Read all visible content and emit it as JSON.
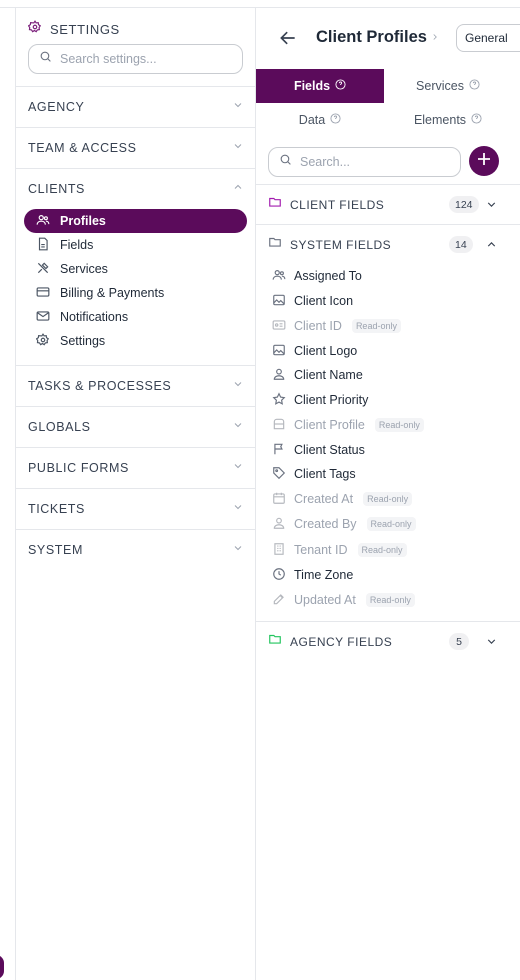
{
  "sidebar": {
    "header": "SETTINGS",
    "search_placeholder": "Search settings...",
    "sections": [
      {
        "label": "AGENCY",
        "expanded": false
      },
      {
        "label": "TEAM & ACCESS",
        "expanded": false
      },
      {
        "label": "CLIENTS",
        "expanded": true
      },
      {
        "label": "TASKS & PROCESSES",
        "expanded": false
      },
      {
        "label": "GLOBALS",
        "expanded": false
      },
      {
        "label": "PUBLIC FORMS",
        "expanded": false
      },
      {
        "label": "TICKETS",
        "expanded": false
      },
      {
        "label": "SYSTEM",
        "expanded": false
      }
    ],
    "clients_items": [
      {
        "label": "Profiles",
        "icon": "users-icon",
        "active": true
      },
      {
        "label": "Fields",
        "icon": "document-icon",
        "active": false
      },
      {
        "label": "Services",
        "icon": "tools-icon",
        "active": false
      },
      {
        "label": "Billing & Payments",
        "icon": "credit-card-icon",
        "active": false
      },
      {
        "label": "Notifications",
        "icon": "mail-icon",
        "active": false
      },
      {
        "label": "Settings",
        "icon": "gear-icon",
        "active": false
      }
    ]
  },
  "header": {
    "title": "Client Profiles",
    "select_value": "General"
  },
  "tabs": [
    {
      "label": "Fields",
      "active": true
    },
    {
      "label": "Services",
      "active": false
    },
    {
      "label": "Data",
      "active": false
    },
    {
      "label": "Elements",
      "active": false
    }
  ],
  "search_placeholder": "Search...",
  "groups": {
    "client": {
      "label": "CLIENT FIELDS",
      "count": "124",
      "expanded": false
    },
    "system": {
      "label": "SYSTEM FIELDS",
      "count": "14",
      "expanded": true
    },
    "agency": {
      "label": "AGENCY FIELDS",
      "count": "5",
      "expanded": false
    }
  },
  "readonly_label": "Read-only",
  "system_fields": [
    {
      "label": "Assigned To",
      "icon": "users-icon",
      "readonly": false
    },
    {
      "label": "Client Icon",
      "icon": "image-icon",
      "readonly": false
    },
    {
      "label": "Client ID",
      "icon": "id-card-icon",
      "readonly": true
    },
    {
      "label": "Client Logo",
      "icon": "image-icon",
      "readonly": false
    },
    {
      "label": "Client Name",
      "icon": "person-icon",
      "readonly": false
    },
    {
      "label": "Client Priority",
      "icon": "star-icon",
      "readonly": false
    },
    {
      "label": "Client Profile",
      "icon": "folder-card-icon",
      "readonly": true
    },
    {
      "label": "Client Status",
      "icon": "flag-icon",
      "readonly": false
    },
    {
      "label": "Client Tags",
      "icon": "tag-icon",
      "readonly": false
    },
    {
      "label": "Created At",
      "icon": "calendar-icon",
      "readonly": true
    },
    {
      "label": "Created By",
      "icon": "person-icon",
      "readonly": true
    },
    {
      "label": "Tenant ID",
      "icon": "building-icon",
      "readonly": true
    },
    {
      "label": "Time Zone",
      "icon": "clock-icon",
      "readonly": false
    },
    {
      "label": "Updated At",
      "icon": "edit-icon",
      "readonly": true
    }
  ],
  "colors": {
    "brand": "#5b0b5b",
    "client_folder": "#a21caf",
    "system_folder": "#6b7280",
    "agency_folder": "#22c55e"
  }
}
